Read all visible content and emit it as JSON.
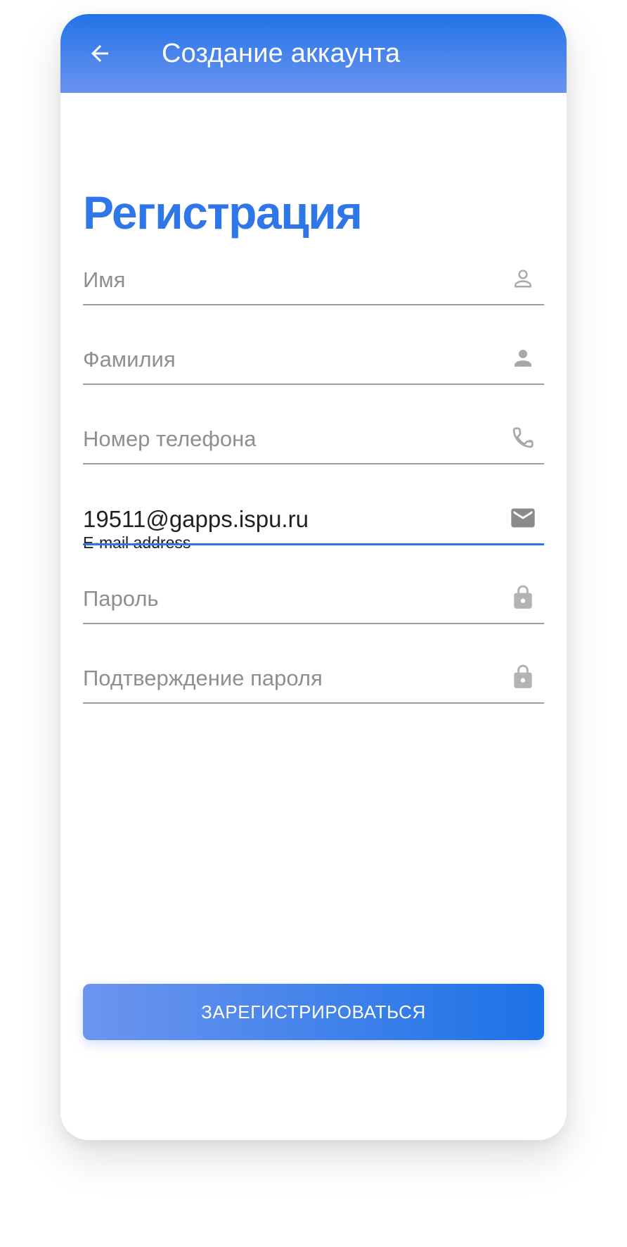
{
  "appbar": {
    "title": "Создание аккаунта",
    "back_icon": "arrow-back-icon"
  },
  "heading": "Регистрация",
  "form": {
    "first_name": {
      "placeholder": "Имя",
      "icon": "person-outline-icon"
    },
    "last_name": {
      "placeholder": "Фамилия",
      "icon": "person-icon"
    },
    "phone": {
      "placeholder": "Номер телефона",
      "icon": "phone-icon"
    },
    "email": {
      "label": "E-mail address",
      "value": "19511@gapps.ispu.ru",
      "icon": "mail-icon"
    },
    "password": {
      "placeholder": "Пароль",
      "icon": "lock-icon"
    },
    "confirm_password": {
      "placeholder": "Подтверждение пароля",
      "icon": "lock-open-icon"
    }
  },
  "submit_label": "ЗАРЕГИСТРИРОВАТЬСЯ",
  "colors": {
    "accent": "#2f76e9",
    "appbar_top": "#2273e8",
    "appbar_bottom": "#6b93ef",
    "underline": "#9e9e9e",
    "icon": "#a8a8a8"
  }
}
